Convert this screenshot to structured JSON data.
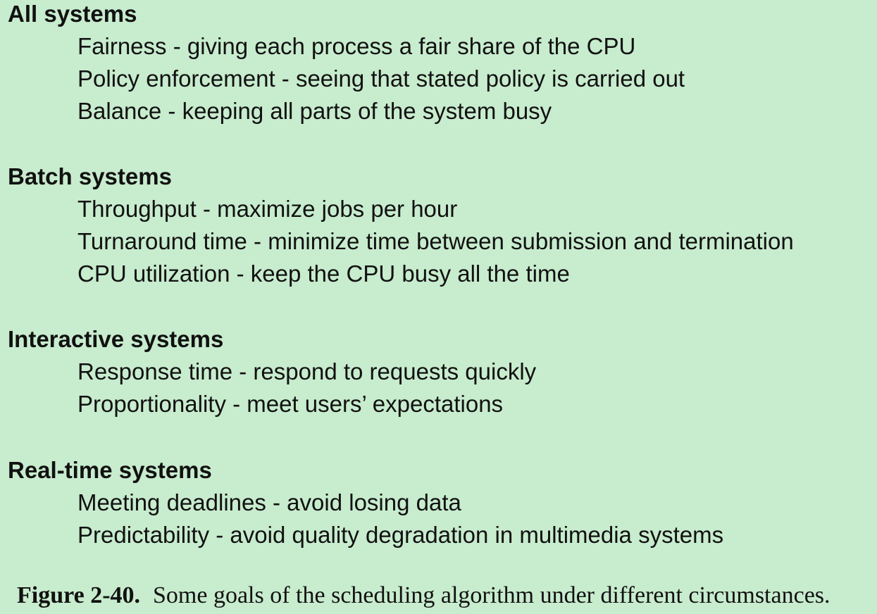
{
  "sections": [
    {
      "heading": "All systems",
      "items": [
        "Fairness - giving each process a fair share of the CPU",
        "Policy enforcement - seeing that stated policy is carried out",
        "Balance - keeping all parts of the system busy"
      ]
    },
    {
      "heading": "Batch systems",
      "items": [
        "Throughput - maximize jobs per hour",
        "Turnaround time - minimize time between submission and termination",
        "CPU utilization - keep the CPU busy all the time"
      ]
    },
    {
      "heading": "Interactive systems",
      "items": [
        "Response time - respond to requests quickly",
        "Proportionality - meet users’ expectations"
      ]
    },
    {
      "heading": "Real-time systems",
      "items": [
        "Meeting deadlines - avoid losing data",
        "Predictability - avoid quality degradation in multimedia systems"
      ]
    }
  ],
  "caption": {
    "label": "Figure 2-40.",
    "text": "Some goals of the scheduling algorithm under different circumstances."
  },
  "colors": {
    "background": "#c8ecce",
    "text": "#111111"
  }
}
